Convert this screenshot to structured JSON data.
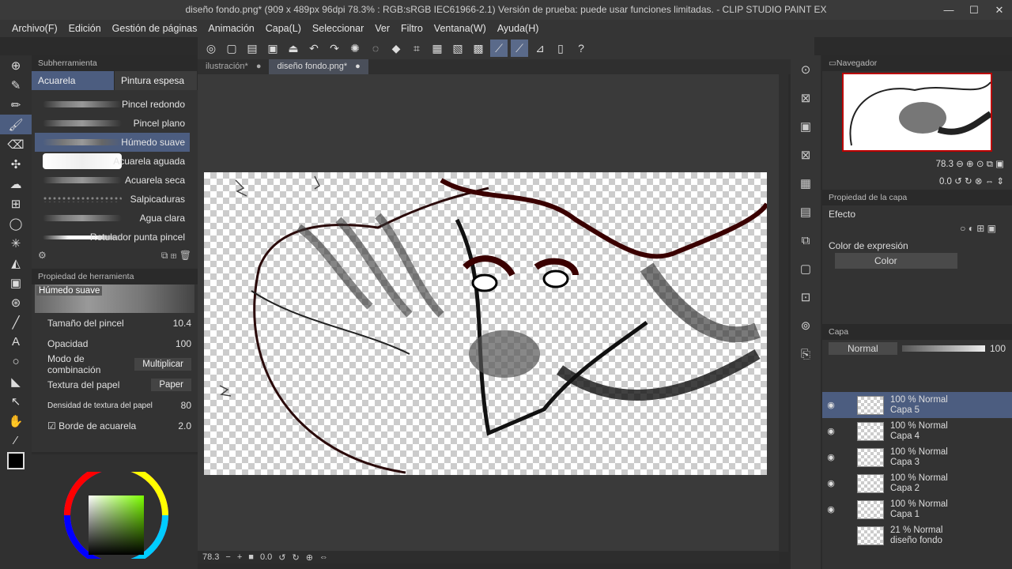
{
  "window": {
    "title": "diseño fondo.png* (909 x 489px 96dpi 78.3% : RGB:sRGB IEC61966-2.1)  Versión de prueba: puede usar funciones limitadas. - CLIP STUDIO PAINT EX",
    "minimize": "—",
    "maximize": "☐",
    "close": "✕"
  },
  "menu": [
    "Archivo(F)",
    "Edición",
    "Gestión de páginas",
    "Animación",
    "Capa(L)",
    "Seleccionar",
    "Ver",
    "Filtro",
    "Ventana(W)",
    "Ayuda(H)"
  ],
  "subtool": {
    "header": "Subherramienta",
    "tab1": "Acuarela",
    "tab2": "Pintura espesa",
    "brushes": [
      "Pincel redondo",
      "Pincel plano",
      "Húmedo suave",
      "Acuarela aguada",
      "Acuarela seca",
      "Salpicaduras",
      "Agua clara",
      "Rotulador punta pincel"
    ]
  },
  "toolprop": {
    "header": "Propiedad de herramienta",
    "name": "Húmedo suave",
    "brush_size_label": "Tamaño del pincel",
    "brush_size": "10.4",
    "opacity_label": "Opacidad",
    "opacity": "100",
    "blend_label": "Modo de combinación",
    "blend": "Multiplicar",
    "texture_label": "Textura del papel",
    "texture": "Paper",
    "density_label": "Densidad de textura del papel",
    "density": "80",
    "watercolor_edge_label": "Borde de acuarela",
    "watercolor_edge": "2.0"
  },
  "doc_tabs": [
    "ilustración*",
    "diseño fondo.png*"
  ],
  "status": {
    "zoom": "78.3",
    "angle": "0.0"
  },
  "navigator": {
    "header": "Navegador",
    "zoom": "78.3",
    "rotation": "0.0"
  },
  "layer_property": {
    "header": "Propiedad de la capa",
    "effect_label": "Efecto",
    "expression_label": "Color de expresión",
    "expression": "Color"
  },
  "layers": {
    "header": "Capa",
    "blend": "Normal",
    "opacity": "100",
    "items": [
      {
        "mode": "100 % Normal",
        "name": "Capa 5"
      },
      {
        "mode": "100 % Normal",
        "name": "Capa 4"
      },
      {
        "mode": "100 % Normal",
        "name": "Capa 3"
      },
      {
        "mode": "100 % Normal",
        "name": "Capa 2"
      },
      {
        "mode": "100 % Normal",
        "name": "Capa 1"
      },
      {
        "mode": "21 % Normal",
        "name": "diseño fondo"
      }
    ]
  }
}
